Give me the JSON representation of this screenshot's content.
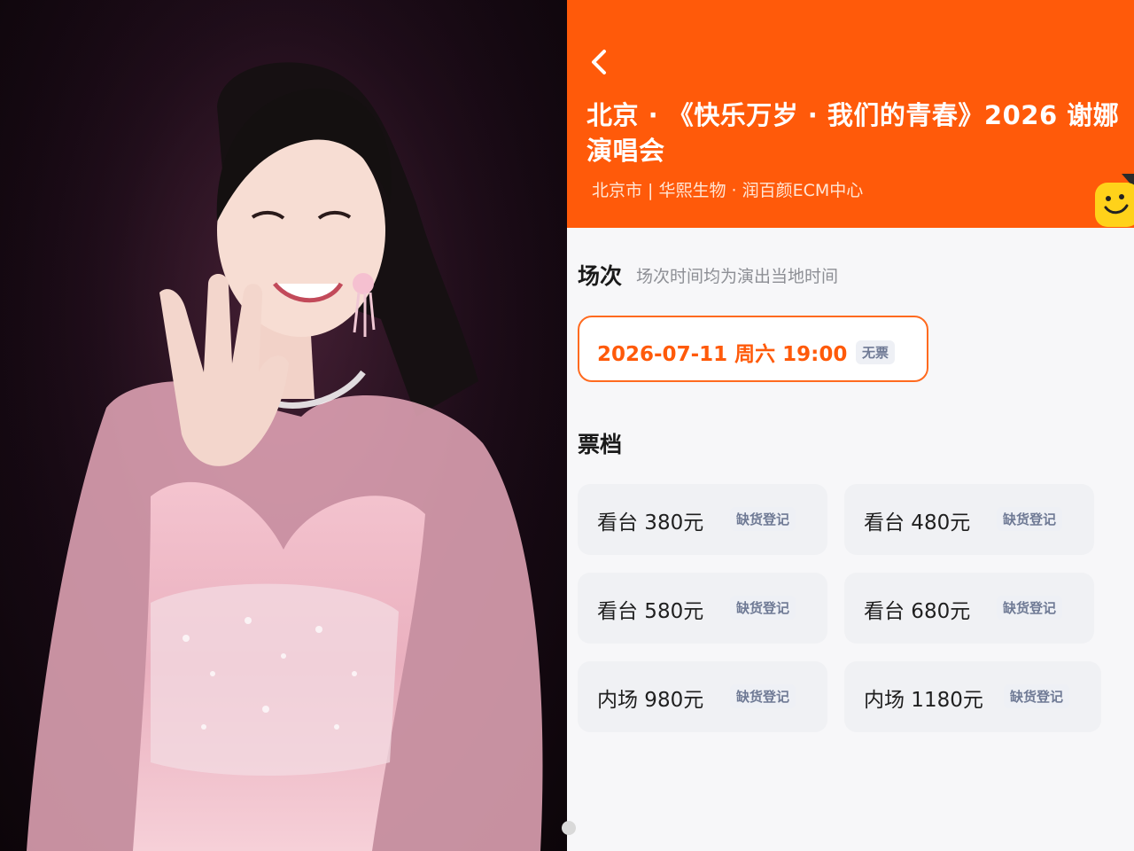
{
  "photo": {
    "description_icon": "singer-photo",
    "colors": {
      "backdrop": "#1b0b18",
      "dress": "#f2b9c6",
      "hair": "#141010",
      "skin": "#f7ddd3"
    }
  },
  "app": {
    "header": {
      "title": "北京 · 《快乐万岁 · 我们的青春》2026 谢娜演唱会",
      "venue": "北京市 | 华熙生物 · 润百颜ECM中心",
      "back_icon": "chevron-left-icon",
      "mascot_icon": "smiley-mascot-icon",
      "color": "#ff5a0a"
    },
    "session": {
      "section_title": "场次",
      "note": "场次时间均为演出当地时间",
      "selected": {
        "text": "2026-07-11  周六 19:00",
        "tag": "无票"
      }
    },
    "tickets": {
      "section_title": "票档",
      "items": [
        {
          "label": "看台 380元",
          "tag": "缺货登记"
        },
        {
          "label": "看台 480元",
          "tag": "缺货登记"
        },
        {
          "label": "看台 580元",
          "tag": "缺货登记"
        },
        {
          "label": "看台 680元",
          "tag": "缺货登记"
        },
        {
          "label": "内场 980元",
          "tag": "缺货登记"
        },
        {
          "label": "内场 1180元",
          "tag": "缺货登记"
        }
      ]
    }
  }
}
